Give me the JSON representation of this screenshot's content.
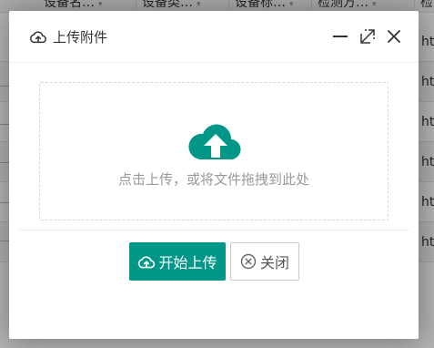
{
  "background_table": {
    "headers": [
      "设备名…",
      "设备类…",
      "设备标…",
      "检测方…",
      "检"
    ],
    "cell_prefix": "ht",
    "row_count": 6
  },
  "dialog": {
    "title": "上传附件",
    "drop_zone_text": "点击上传，或将文件拖拽到此处",
    "start_button": "开始上传",
    "close_button": "关闭"
  },
  "icons": {
    "title": "cloud-upload-outline-icon",
    "minimize": "minimize-icon",
    "maximize": "maximize-icon",
    "close": "close-icon",
    "drop_zone": "cloud-upload-filled-icon",
    "start": "cloud-upload-icon",
    "cancel": "circle-x-icon"
  },
  "colors": {
    "accent": "#009688",
    "overlay": "rgba(0,0,0,0.3)",
    "muted_text": "#999999"
  }
}
